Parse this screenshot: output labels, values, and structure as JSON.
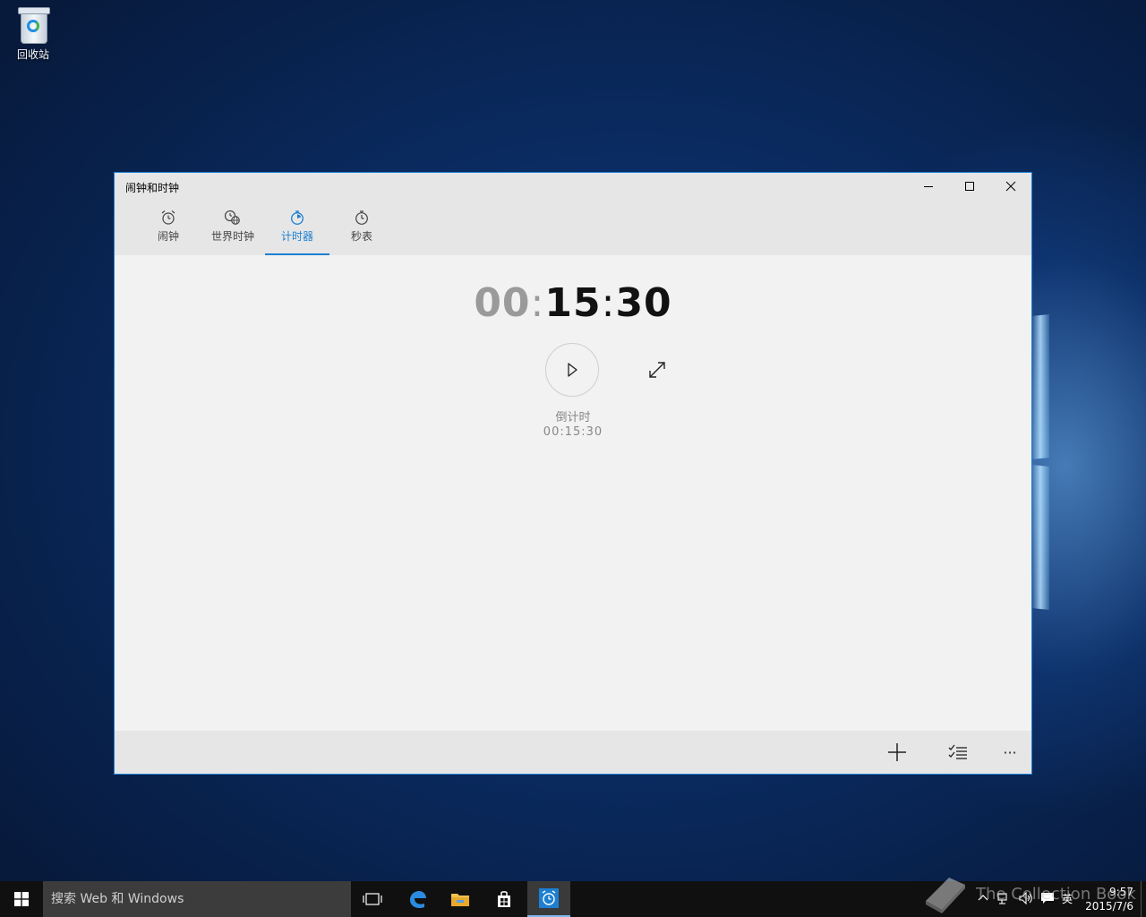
{
  "desktop": {
    "recycle_bin_label": "回收站"
  },
  "window": {
    "title": "闹钟和时钟",
    "controls": {
      "minimize_icon": "minimize-icon",
      "maximize_icon": "maximize-icon",
      "close_icon": "close-icon"
    },
    "tabs": [
      {
        "label": "闹钟",
        "icon": "alarm-clock-icon",
        "active": false
      },
      {
        "label": "世界时钟",
        "icon": "world-clock-icon",
        "active": false
      },
      {
        "label": "计时器",
        "icon": "timer-icon",
        "active": true
      },
      {
        "label": "秒表",
        "icon": "stopwatch-icon",
        "active": false
      }
    ],
    "timer": {
      "hours": "00",
      "minutes": "15",
      "seconds": "30",
      "separator": ":",
      "name": "倒计时",
      "length": "00:15:30"
    },
    "app_bar": {
      "add_icon": "add-icon",
      "select_icon": "select-list-icon",
      "more_label": "···"
    },
    "accent_color": "#1c7fd1"
  },
  "taskbar": {
    "search_placeholder": "搜索 Web 和 Windows",
    "apps": [
      "task-view-icon",
      "edge-icon",
      "file-explorer-icon",
      "store-icon",
      "alarms-clock-app-icon"
    ],
    "tray": {
      "ime": "英",
      "time": "9:57",
      "date": "2015/7/6"
    }
  },
  "watermark": "The Collection Book"
}
